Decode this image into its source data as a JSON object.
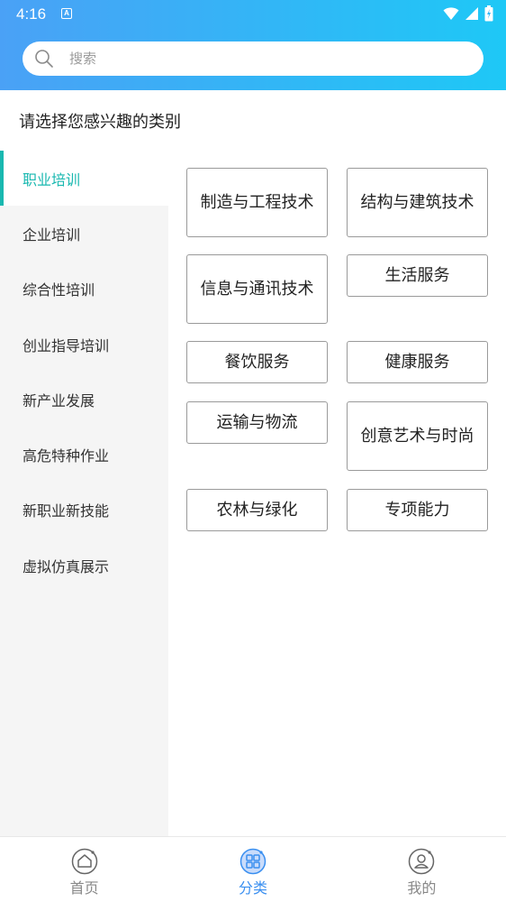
{
  "status_bar": {
    "time": "4:16",
    "notification_badge": "A"
  },
  "search": {
    "placeholder": "搜索"
  },
  "page_title": "请选择您感兴趣的类别",
  "sidebar": {
    "items": [
      {
        "label": "职业培训",
        "active": true
      },
      {
        "label": "企业培训"
      },
      {
        "label": "综合性培训"
      },
      {
        "label": "创业指导培训"
      },
      {
        "label": "新产业发展"
      },
      {
        "label": "高危特种作业"
      },
      {
        "label": "新职业新技能"
      },
      {
        "label": "虚拟仿真展示"
      }
    ]
  },
  "categories": [
    {
      "label": "制造与工程技术"
    },
    {
      "label": "结构与建筑技术"
    },
    {
      "label": "信息与通讯技术"
    },
    {
      "label": "生活服务"
    },
    {
      "label": "餐饮服务"
    },
    {
      "label": "健康服务"
    },
    {
      "label": "运输与物流"
    },
    {
      "label": "创意艺术与时尚"
    },
    {
      "label": "农林与绿化"
    },
    {
      "label": "专项能力"
    }
  ],
  "bottom_nav": {
    "items": [
      {
        "label": "首页",
        "icon": "home-icon"
      },
      {
        "label": "分类",
        "icon": "category-icon",
        "active": true
      },
      {
        "label": "我的",
        "icon": "profile-icon"
      }
    ]
  },
  "colors": {
    "header_start": "#4aa1f6",
    "header_end": "#1ec8f6",
    "sidebar_active": "#19b8b0",
    "nav_active": "#3a8ff0"
  }
}
